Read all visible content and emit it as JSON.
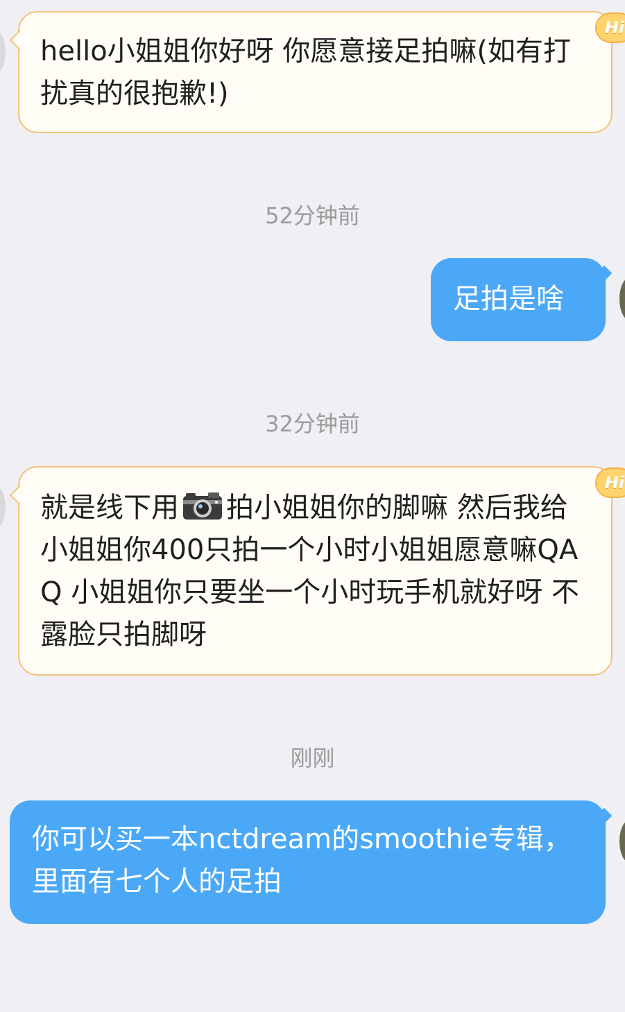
{
  "messages": [
    {
      "from": "other",
      "badge": "Hi",
      "text": "hello小姐姐你好呀 你愿意接足拍嘛(如有打扰真的很抱歉!)"
    },
    {
      "timestamp": "52分钟前"
    },
    {
      "from": "me",
      "text": "足拍是啥"
    },
    {
      "timestamp": "32分钟前"
    },
    {
      "from": "other",
      "badge": "Hi",
      "text_before_icon": "就是线下用",
      "icon": "camera-icon",
      "text_after_icon": "拍小姐姐你的脚嘛 然后我给小姐姐你400只拍一个小时小姐姐愿意嘛QAQ 小姐姐你只要坐一个小时玩手机就好呀 不露脸只拍脚呀"
    },
    {
      "timestamp": "刚刚"
    },
    {
      "from": "me",
      "text": "你可以买一本nctdream的smoothie专辑，里面有七个人的足拍"
    }
  ],
  "colors": {
    "background": "#efeff4",
    "incoming_bubble": "#fffdf6",
    "incoming_border": "#f3c27a",
    "outgoing_bubble": "#4aa8f7",
    "timestamp_text": "#9b9b9b",
    "badge": "#ffd46e"
  }
}
